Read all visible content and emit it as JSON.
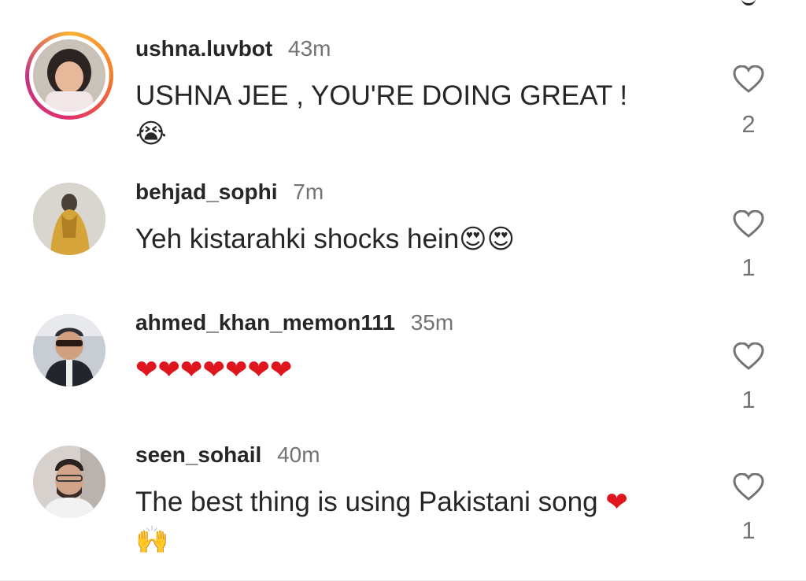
{
  "comments": [
    {
      "username": "ushna.luvbot",
      "time": "43m",
      "text": "USHNA JEE , YOU'RE DOING GREAT !",
      "emoji_line": "😭",
      "likes": "2",
      "has_story_ring": true
    },
    {
      "username": "behjad_sophi",
      "time": "7m",
      "text": "Yeh kistarahki shocks hein",
      "emoji_suffix": "😍😍",
      "likes": "1"
    },
    {
      "username": "ahmed_khan_memon111",
      "time": "35m",
      "emoji_line": "❤❤❤❤❤❤❤",
      "likes": "1"
    },
    {
      "username": "seen_sohail",
      "time": "40m",
      "text": "The best thing is using Pakistani song",
      "emoji_suffix": "❤",
      "emoji_line": "🙌",
      "likes": "1"
    }
  ],
  "colors": {
    "text": "#262626",
    "muted": "#737373",
    "heart_red": "#e0161f"
  }
}
